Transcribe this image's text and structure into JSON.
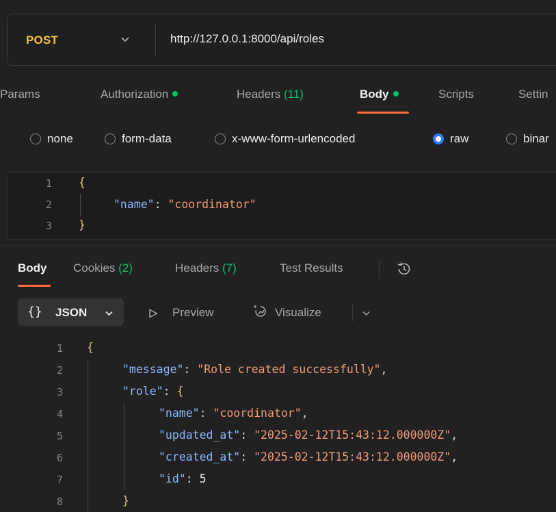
{
  "request": {
    "method": "POST",
    "url": "http://127.0.0.1:8000/api/roles"
  },
  "request_tabs": [
    {
      "label": "Params"
    },
    {
      "label": "Authorization"
    },
    {
      "label": "Headers",
      "count": "(11)"
    },
    {
      "label": "Body"
    },
    {
      "label": "Scripts"
    },
    {
      "label": "Settin"
    }
  ],
  "body_modes": [
    {
      "label": "none",
      "selected": false
    },
    {
      "label": "form-data",
      "selected": false
    },
    {
      "label": "x-www-form-urlencoded",
      "selected": false
    },
    {
      "label": "raw",
      "selected": true
    },
    {
      "label": "binar",
      "selected": false
    }
  ],
  "request_body": {
    "line_numbers": [
      "1",
      "2",
      "3"
    ],
    "open_brace": "{",
    "key": "\"name\"",
    "colon": ": ",
    "value": "\"coordinator\"",
    "close_brace": "}"
  },
  "response_tabs": [
    {
      "label": "Body"
    },
    {
      "label": "Cookies",
      "count": "(2)"
    },
    {
      "label": "Headers",
      "count": "(7)"
    },
    {
      "label": "Test Results"
    }
  ],
  "response_toolbar": {
    "format_braces": "{}",
    "format_label": "JSON",
    "preview_label": "Preview",
    "visualize_label": "Visualize"
  },
  "response_body": {
    "line_numbers": [
      "1",
      "2",
      "3",
      "4",
      "5",
      "6",
      "7",
      "8"
    ],
    "open_brace": "{",
    "message_key": "\"message\"",
    "message_value": "\"Role created successfully\"",
    "role_key": "\"role\"",
    "name_key": "\"name\"",
    "name_value": "\"coordinator\"",
    "updated_at_key": "\"updated_at\"",
    "updated_at_value": "\"2025-02-12T15:43:12.000000Z\"",
    "created_at_key": "\"created_at\"",
    "created_at_value": "\"2025-02-12T15:43:12.000000Z\"",
    "id_key": "\"id\"",
    "id_value": "5",
    "role_close_brace": "}"
  },
  "colors": {
    "accent": "#ff6c37",
    "method": "#f5c242",
    "status_dot": "#0fbf6a",
    "radio_selected": "#2f7bff",
    "json_key": "#8fb8ff",
    "json_string": "#f49b7a"
  }
}
